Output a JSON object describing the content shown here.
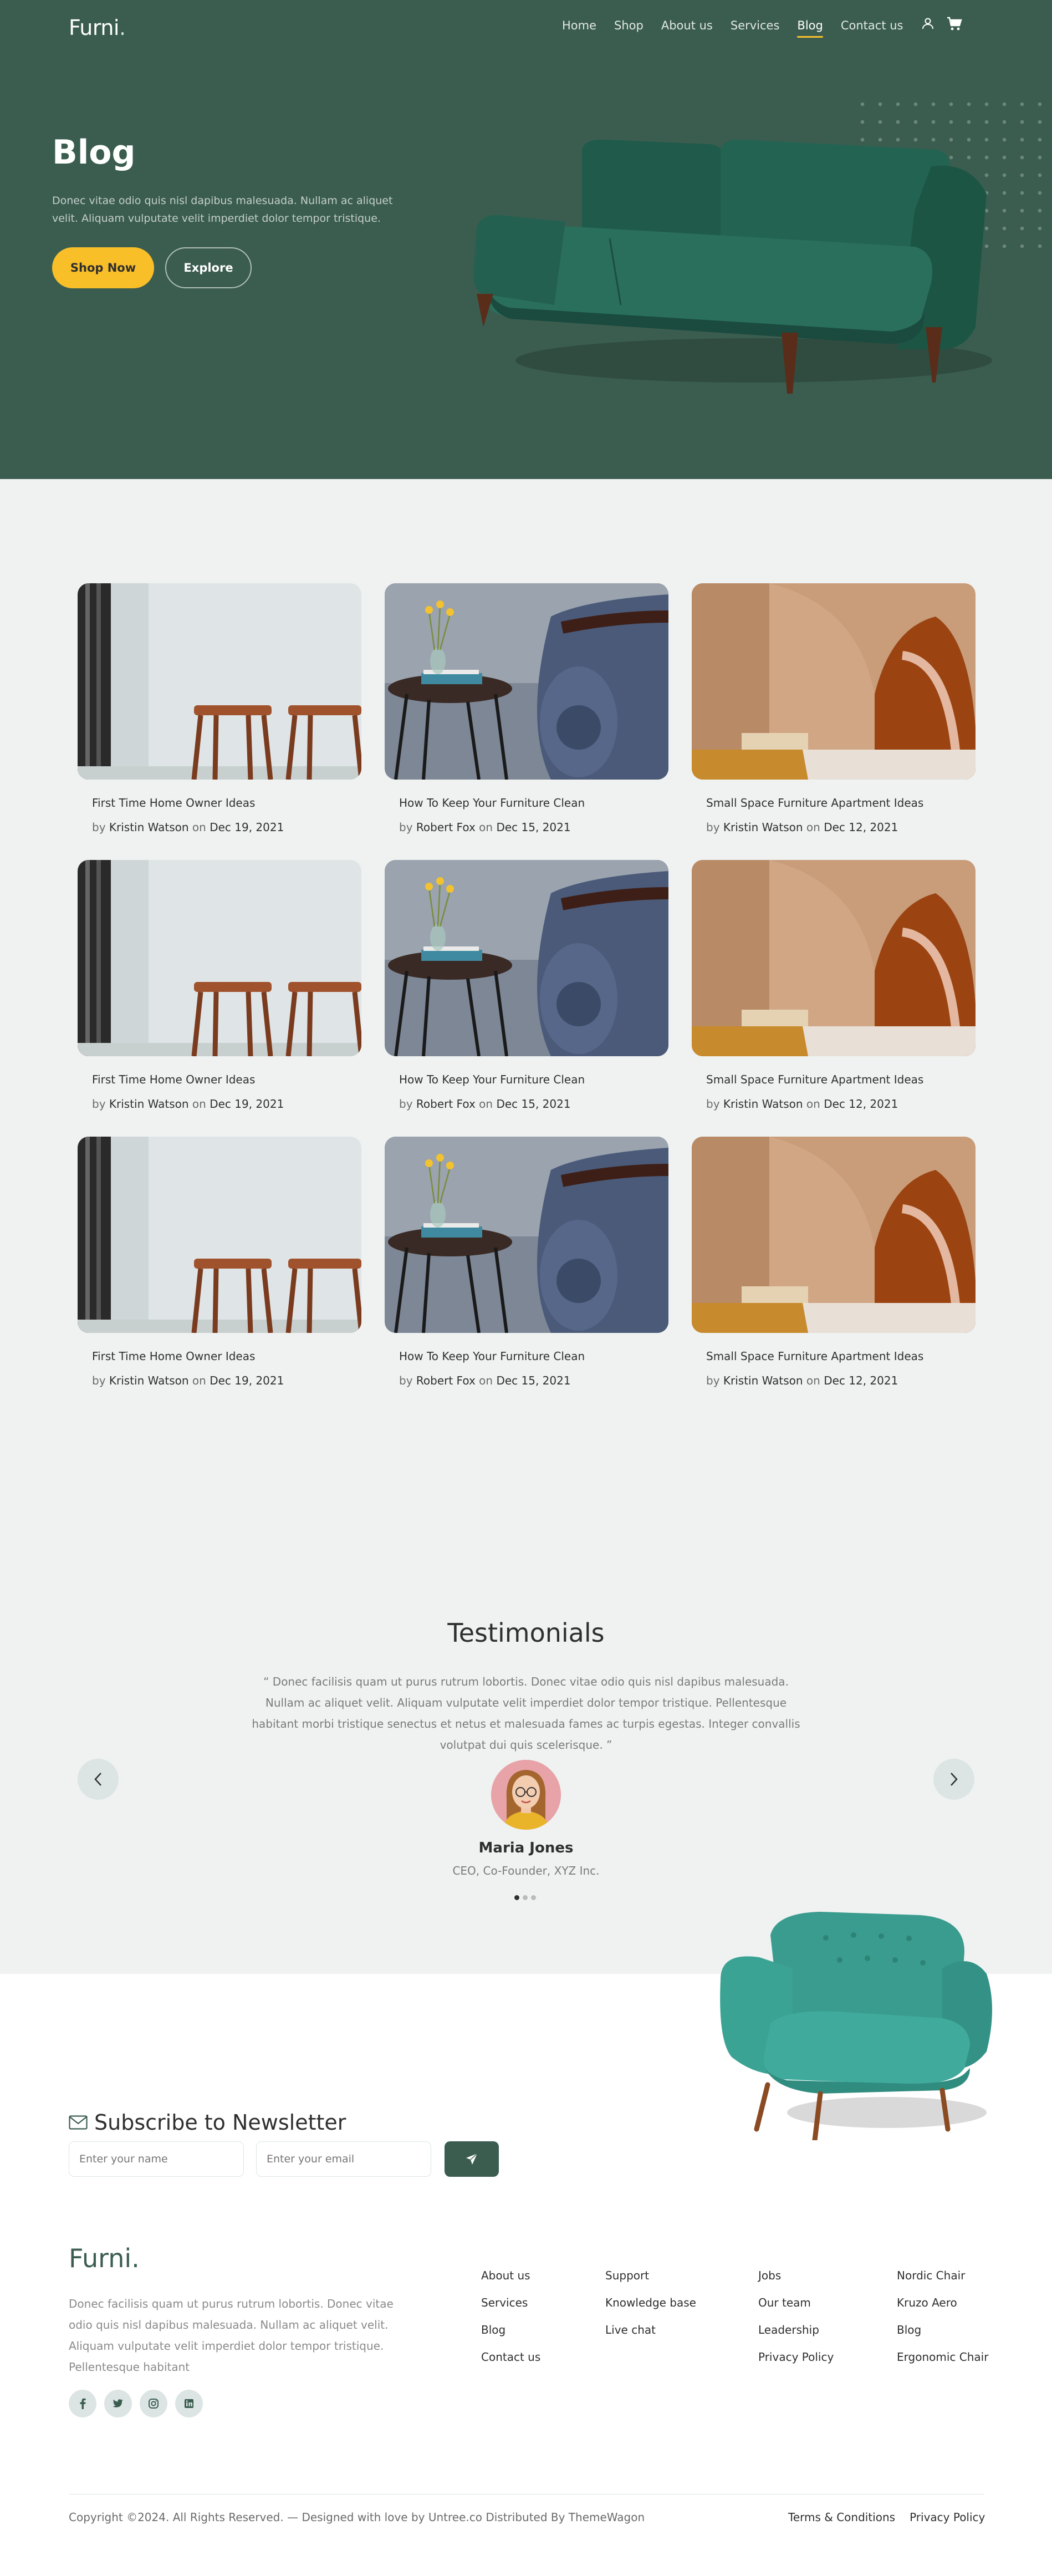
{
  "nav": {
    "logo": "Furni",
    "logo_dot": ".",
    "links": [
      {
        "label": "Home"
      },
      {
        "label": "Shop"
      },
      {
        "label": "About us"
      },
      {
        "label": "Services"
      },
      {
        "label": "Blog"
      },
      {
        "label": "Contact us"
      }
    ],
    "active": "Blog",
    "icons": [
      "user-icon",
      "cart-icon"
    ]
  },
  "hero": {
    "title": "Blog",
    "subtitle": "Donec vitae odio quis nisl dapibus malesuada. Nullam ac aliquet velit. Aliquam vulputate velit imperdiet dolor tempor tristique.",
    "primary_button": "Shop Now",
    "secondary_button": "Explore"
  },
  "posts": [
    {
      "title": "First Time Home Owner Ideas",
      "by": "by",
      "author": "Kristin Watson",
      "on": "on",
      "date": "Dec 19, 2021"
    },
    {
      "title": "How To Keep Your Furniture Clean",
      "by": "by",
      "author": "Robert Fox",
      "on": "on",
      "date": "Dec 15, 2021"
    },
    {
      "title": "Small Space Furniture Apartment Ideas",
      "by": "by",
      "author": "Kristin Watson",
      "on": "on",
      "date": "Dec 12, 2021"
    },
    {
      "title": "First Time Home Owner Ideas",
      "by": "by",
      "author": "Kristin Watson",
      "on": "on",
      "date": "Dec 19, 2021"
    },
    {
      "title": "How To Keep Your Furniture Clean",
      "by": "by",
      "author": "Robert Fox",
      "on": "on",
      "date": "Dec 15, 2021"
    },
    {
      "title": "Small Space Furniture Apartment Ideas",
      "by": "by",
      "author": "Kristin Watson",
      "on": "on",
      "date": "Dec 12, 2021"
    },
    {
      "title": "First Time Home Owner Ideas",
      "by": "by",
      "author": "Kristin Watson",
      "on": "on",
      "date": "Dec 19, 2021"
    },
    {
      "title": "How To Keep Your Furniture Clean",
      "by": "by",
      "author": "Robert Fox",
      "on": "on",
      "date": "Dec 15, 2021"
    },
    {
      "title": "Small Space Furniture Apartment Ideas",
      "by": "by",
      "author": "Kristin Watson",
      "on": "on",
      "date": "Dec 12, 2021"
    }
  ],
  "testimonials": {
    "title": "Testimonials",
    "quote": "“ Donec facilisis quam ut purus rutrum lobortis. Donec vitae odio quis nisl dapibus malesuada. Nullam ac aliquet velit. Aliquam vulputate velit imperdiet dolor tempor tristique. Pellentesque habitant morbi tristique senectus et netus et malesuada fames ac turpis egestas. Integer convallis volutpat dui quis scelerisque. ”",
    "name": "Maria Jones",
    "role": "CEO, Co-Founder, XYZ Inc.",
    "slide_count": 3,
    "active_slide": 1
  },
  "newsletter": {
    "title": "Subscribe to Newsletter",
    "name_placeholder": "Enter your name",
    "email_placeholder": "Enter your email"
  },
  "footer": {
    "logo": "Furni.",
    "about": "Donec facilisis quam ut purus rutrum lobortis. Donec vitae odio quis nisl dapibus malesuada. Nullam ac aliquet velit. Aliquam vulputate velit imperdiet dolor tempor tristique. Pellentesque habitant",
    "socials": [
      "facebook-icon",
      "twitter-icon",
      "instagram-icon",
      "linkedin-icon"
    ],
    "columns": [
      [
        "About us",
        "Services",
        "Blog",
        "Contact us"
      ],
      [
        "Support",
        "Knowledge base",
        "Live chat"
      ],
      [
        "Jobs",
        "Our team",
        "Leadership",
        "Privacy Policy"
      ],
      [
        "Nordic Chair",
        "Kruzo Aero",
        "Blog",
        "Ergonomic Chair"
      ]
    ],
    "copyright": "Copyright ©2024. All Rights Reserved. — Designed with love by Untree.co Distributed By ThemeWagon",
    "terms": "Terms & Conditions",
    "privacy": "Privacy Policy"
  },
  "colors": {
    "brand_green": "#3b5d50",
    "accent_yellow": "#f9bf29",
    "page_bg": "#eff2f1"
  }
}
